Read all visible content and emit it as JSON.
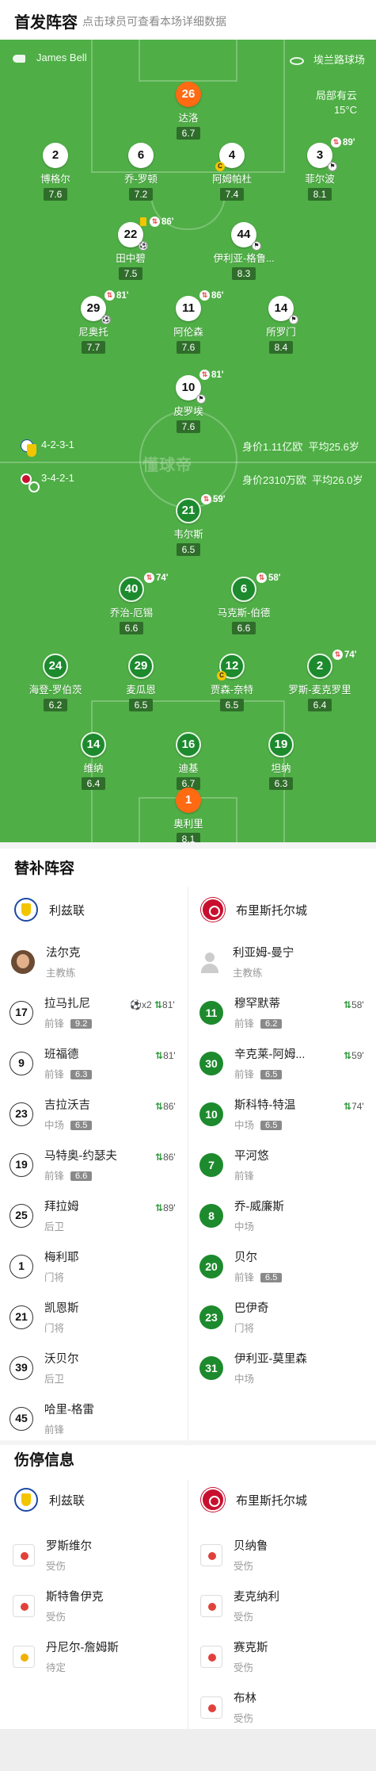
{
  "header": {
    "title": "首发阵容",
    "subtitle": "点击球员可查看本场详细数据"
  },
  "match_info": {
    "referee": "James Bell",
    "stadium": "埃兰路球场",
    "weather": "局部有云",
    "temperature": "15°C"
  },
  "formations": {
    "home": {
      "formation": "4-2-3-1",
      "value": "身价1.11亿欧",
      "avg_age": "平均25.6岁"
    },
    "away": {
      "formation": "3-4-2-1",
      "value": "身价2310万欧",
      "avg_age": "平均26.0岁"
    }
  },
  "watermark": "懂球帝",
  "home_lineup": [
    {
      "number": "26",
      "name": "达洛",
      "rating": "6.7",
      "style": "orange"
    },
    {
      "number": "2",
      "name": "博格尔",
      "rating": "7.6"
    },
    {
      "number": "6",
      "name": "乔-罗顿",
      "rating": "7.2"
    },
    {
      "number": "4",
      "name": "阿姆帕杜",
      "rating": "7.4",
      "captain": "C"
    },
    {
      "number": "3",
      "name": "菲尔波",
      "rating": "8.1",
      "sub_minute": "89'"
    },
    {
      "number": "22",
      "name": "田中碧",
      "rating": "7.5",
      "sub_minute": "86'"
    },
    {
      "number": "44",
      "name": "伊利亚-格鲁...",
      "rating": "8.3"
    },
    {
      "number": "29",
      "name": "尼奥托",
      "rating": "7.7",
      "sub_minute": "81'"
    },
    {
      "number": "11",
      "name": "阿伦森",
      "rating": "7.6",
      "sub_minute": "86'"
    },
    {
      "number": "14",
      "name": "所罗门",
      "rating": "8.4"
    },
    {
      "number": "10",
      "name": "皮罗埃",
      "rating": "7.6",
      "sub_minute": "81'"
    }
  ],
  "away_lineup": [
    {
      "number": "21",
      "name": "韦尔斯",
      "rating": "6.5",
      "sub_minute": "59'"
    },
    {
      "number": "40",
      "name": "乔治-厄锡",
      "rating": "6.6",
      "sub_minute": "74'"
    },
    {
      "number": "6",
      "name": "马克斯-伯德",
      "rating": "6.6",
      "sub_minute": "58'"
    },
    {
      "number": "24",
      "name": "海登-罗伯茨",
      "rating": "6.2"
    },
    {
      "number": "29",
      "name": "麦瓜恩",
      "rating": "6.5"
    },
    {
      "number": "12",
      "name": "贾森-奈特",
      "rating": "6.5",
      "captain": "C"
    },
    {
      "number": "2",
      "name": "罗斯-麦克罗里",
      "rating": "6.4",
      "sub_minute": "74'"
    },
    {
      "number": "14",
      "name": "维纳",
      "rating": "6.4"
    },
    {
      "number": "16",
      "name": "迪基",
      "rating": "6.7"
    },
    {
      "number": "19",
      "name": "坦纳",
      "rating": "6.3"
    },
    {
      "number": "1",
      "name": "奥利里",
      "rating": "8.1",
      "style": "orange"
    }
  ],
  "substitutes": {
    "title": "替补阵容",
    "home_team": "利兹联",
    "away_team": "布里斯托尔城",
    "home_coach": {
      "name": "法尔克",
      "role": "主教练"
    },
    "away_coach": {
      "name": "利亚姆-曼宁",
      "role": "主教练"
    },
    "home": [
      {
        "number": "17",
        "name": "拉马扎尼",
        "position": "前锋",
        "rating": "9.2",
        "goals": "x2",
        "sub_in": "81'"
      },
      {
        "number": "9",
        "name": "班福德",
        "position": "前锋",
        "rating": "6.3",
        "sub_in": "81'"
      },
      {
        "number": "23",
        "name": "吉拉沃吉",
        "position": "中场",
        "rating": "6.5",
        "sub_in": "86'"
      },
      {
        "number": "19",
        "name": "马特奥-约瑟夫",
        "position": "前锋",
        "rating": "6.6",
        "sub_in": "86'"
      },
      {
        "number": "25",
        "name": "拜拉姆",
        "position": "后卫",
        "sub_in": "89'"
      },
      {
        "number": "1",
        "name": "梅利耶",
        "position": "门将"
      },
      {
        "number": "21",
        "name": "凯恩斯",
        "position": "门将"
      },
      {
        "number": "39",
        "name": "沃贝尔",
        "position": "后卫"
      },
      {
        "number": "45",
        "name": "哈里-格雷",
        "position": "前锋"
      }
    ],
    "away": [
      {
        "number": "11",
        "name": "穆罕默蒂",
        "position": "前锋",
        "rating": "6.2",
        "sub_in": "58'"
      },
      {
        "number": "30",
        "name": "辛克莱-阿姆...",
        "position": "前锋",
        "rating": "6.5",
        "sub_in": "59'"
      },
      {
        "number": "10",
        "name": "斯科特-特温",
        "position": "中场",
        "rating": "6.5",
        "sub_in": "74'"
      },
      {
        "number": "7",
        "name": "平河悠",
        "position": "前锋"
      },
      {
        "number": "8",
        "name": "乔-威廉斯",
        "position": "中场"
      },
      {
        "number": "20",
        "name": "贝尔",
        "position": "前锋",
        "rating": "6.5"
      },
      {
        "number": "23",
        "name": "巴伊奇",
        "position": "门将"
      },
      {
        "number": "31",
        "name": "伊利亚-莫里森",
        "position": "中场"
      }
    ]
  },
  "injuries": {
    "title": "伤停信息",
    "home_team": "利兹联",
    "away_team": "布里斯托尔城",
    "home": [
      {
        "name": "罗斯维尔",
        "status": "受伤",
        "kind": "red"
      },
      {
        "name": "斯特鲁伊克",
        "status": "受伤",
        "kind": "red"
      },
      {
        "name": "丹尼尔-詹姆斯",
        "status": "待定",
        "kind": "yellow"
      }
    ],
    "away": [
      {
        "name": "贝纳鲁",
        "status": "受伤",
        "kind": "red"
      },
      {
        "name": "麦克纳利",
        "status": "受伤",
        "kind": "red"
      },
      {
        "name": "赛克斯",
        "status": "受伤",
        "kind": "red"
      },
      {
        "name": "布林",
        "status": "受伤",
        "kind": "red"
      }
    ]
  },
  "colors": {
    "pitch": "#4fae46",
    "away_kit": "#1d8a2e",
    "goalkeeper": "#ff6a13",
    "sub_in": "#2e9a3c"
  }
}
